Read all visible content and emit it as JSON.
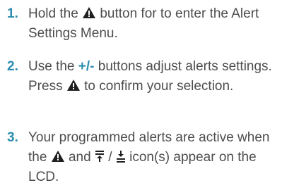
{
  "steps": [
    {
      "number": "1.",
      "parts": {
        "a": "Hold the ",
        "icon1": "alert-triangle-icon",
        "b": " button for to enter the Alert Settings Menu."
      }
    },
    {
      "number": "2.",
      "parts": {
        "a": "Use the ",
        "emphasis": "+/-",
        "b": " buttons adjust alerts settings. Press ",
        "icon1": "alert-triangle-icon",
        "c": " to confirm your selection."
      }
    },
    {
      "number": "3.",
      "parts": {
        "a": "Your programmed alerts are active when the ",
        "icon1": "alert-triangle-icon",
        "b": " and ",
        "icon2": "high-alert-icon",
        "c": " / ",
        "icon3": "low-alert-icon",
        "d": " icon(s) appear on the LCD."
      }
    }
  ],
  "colors": {
    "number": "#2c8db0",
    "text": "#4d4d4d",
    "icon": "#1f1f1f"
  }
}
